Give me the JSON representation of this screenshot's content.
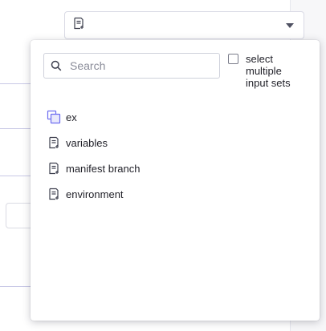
{
  "trigger": {
    "icon": "input-set-icon"
  },
  "popover": {
    "search": {
      "placeholder": "Search",
      "value": ""
    },
    "multi_select": {
      "label": "select multiple input sets",
      "checked": false
    },
    "items": [
      {
        "label": "ex",
        "icon": "overlay-input-set-icon"
      },
      {
        "label": "variables",
        "icon": "input-set-icon"
      },
      {
        "label": "manifest branch",
        "icon": "input-set-icon"
      },
      {
        "label": "environment",
        "icon": "input-set-icon"
      }
    ]
  },
  "colors": {
    "accent": "#6c6cf0",
    "icon": "#3d3f4e",
    "border": "#d9dae5"
  }
}
